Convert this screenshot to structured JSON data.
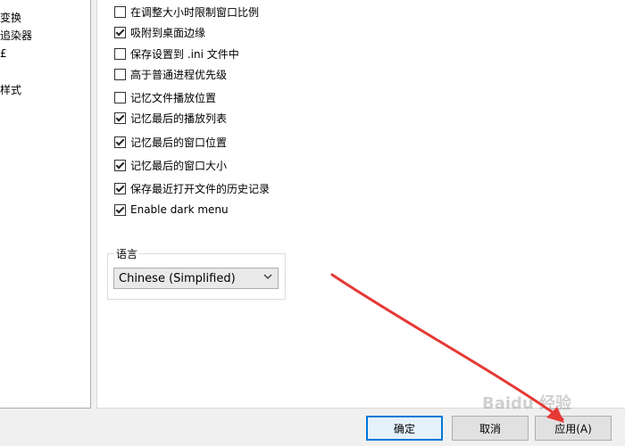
{
  "left_panel": {
    "items": [
      "变换",
      "追染器",
      "£",
      "样式"
    ]
  },
  "options": [
    {
      "label": "在调整大小时限制窗口比例",
      "checked": false
    },
    {
      "label": "吸附到桌面边缘",
      "checked": true
    },
    {
      "label": "保存设置到 .ini 文件中",
      "checked": false
    },
    {
      "label": "高于普通进程优先级",
      "checked": false
    },
    {
      "label": "记忆文件播放位置",
      "checked": false
    },
    {
      "label": "记忆最后的播放列表",
      "checked": true
    },
    {
      "label": "记忆最后的窗口位置",
      "checked": true
    },
    {
      "label": "记忆最后的窗口大小",
      "checked": true
    },
    {
      "label": "保存最近打开文件的历史记录",
      "checked": true
    },
    {
      "label": "Enable dark menu",
      "checked": true
    }
  ],
  "language": {
    "group_label": "语言",
    "selected": "Chinese (Simplified)"
  },
  "buttons": {
    "ok": "确定",
    "cancel": "取消",
    "apply": "应用(A)"
  },
  "watermark": "Baidu 经验",
  "colors": {
    "arrow": "#e53935",
    "default_button_border": "#0078d7"
  }
}
